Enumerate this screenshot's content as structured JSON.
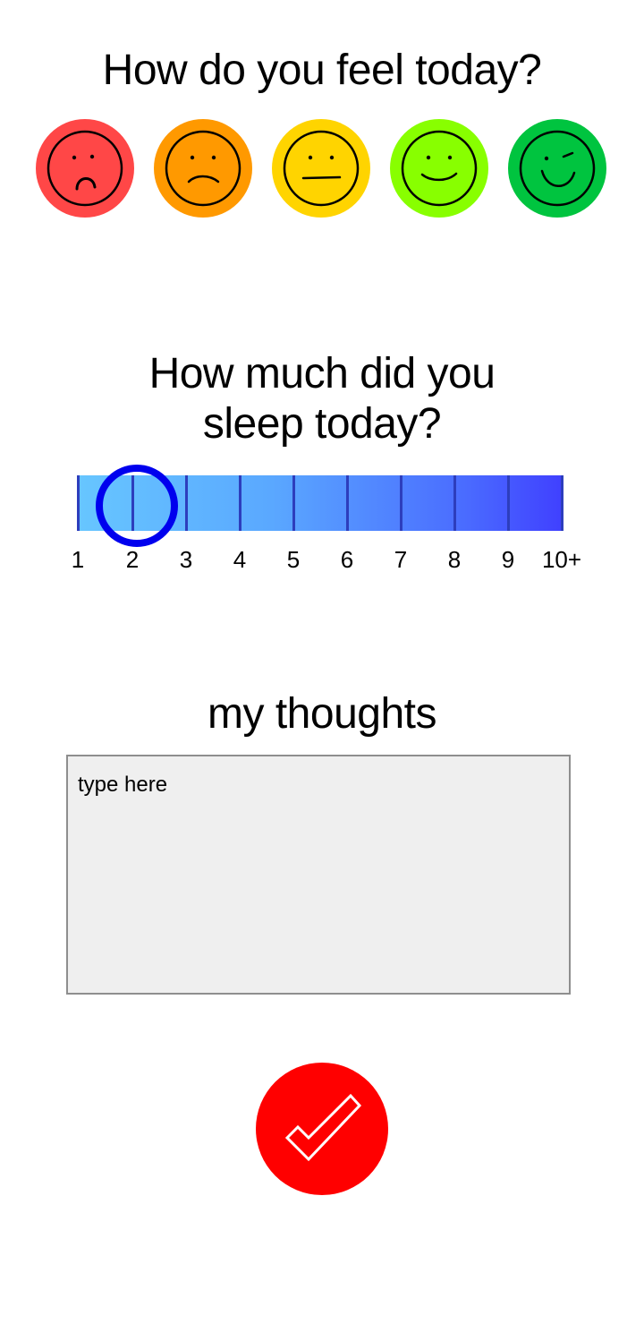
{
  "mood": {
    "title": "How do you feel today?",
    "faces": [
      {
        "name": "very-sad",
        "color": "#ff4747"
      },
      {
        "name": "sad",
        "color": "#ff9900"
      },
      {
        "name": "neutral",
        "color": "#ffd400"
      },
      {
        "name": "happy",
        "color": "#88ff00"
      },
      {
        "name": "very-happy",
        "color": "#00c43f"
      }
    ]
  },
  "sleep": {
    "title_line1": "How much did you",
    "title_line2": "sleep today?",
    "labels": [
      "1",
      "2",
      "3",
      "4",
      "5",
      "6",
      "7",
      "8",
      "9",
      "10+"
    ],
    "selected": "2",
    "thumb_color": "#0000ee"
  },
  "thoughts": {
    "title": "my thoughts",
    "placeholder": "type here",
    "value": ""
  },
  "submit": {
    "icon": "checkmark-icon",
    "color": "#ff0000"
  }
}
